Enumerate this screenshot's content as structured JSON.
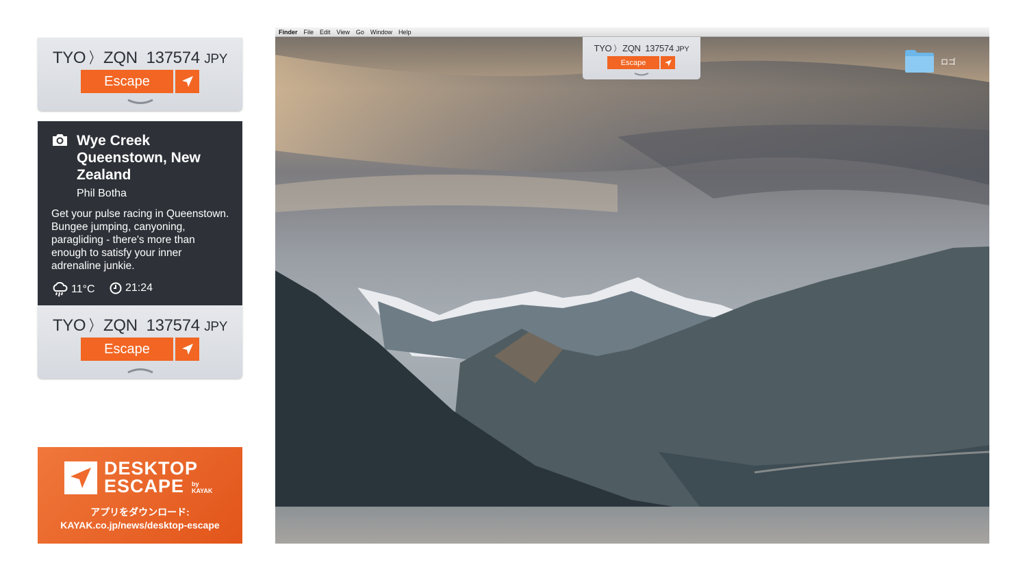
{
  "widget_top": {
    "origin": "TYO",
    "destination": "ZQN",
    "price": "137574",
    "currency": "JPY",
    "escape_label": "Escape"
  },
  "card": {
    "place": "Wye Creek Queenstown, New Zealand",
    "author": "Phil Botha",
    "description": "Get your pulse racing in Queenstown. Bungee jumping, canyoning, paragliding - there's more than enough to satisfy your inner adrenaline junkie.",
    "temperature": "11°C",
    "time": "21:24"
  },
  "widget_bottom": {
    "origin": "TYO",
    "destination": "ZQN",
    "price": "137574",
    "currency": "JPY",
    "escape_label": "Escape"
  },
  "promo": {
    "title_line1": "DESKTOP",
    "title_line2": "ESCAPE",
    "by_line1": "by",
    "by_line2": "KAYAK",
    "download_label": "アプリをダウンロード:",
    "download_url": "KAYAK.co.jp/news/desktop-escape"
  },
  "desktop": {
    "menu": [
      "Finder",
      "File",
      "Edit",
      "View",
      "Go",
      "Window",
      "Help"
    ],
    "mini_widget": {
      "origin": "TYO",
      "destination": "ZQN",
      "price": "137574",
      "currency": "JPY",
      "escape_label": "Escape"
    },
    "folder_label": "ロゴ"
  },
  "colors": {
    "accent": "#f26522",
    "card_bg": "#2e3238",
    "widget_bg": "#dfe1e6"
  },
  "icons": [
    "chevron-right-icon",
    "send-arrow-icon",
    "chevron-down-icon",
    "chevron-up-icon",
    "camera-icon",
    "rain-cloud-icon",
    "clock-icon",
    "kayak-arrow-logo-icon",
    "folder-icon"
  ]
}
